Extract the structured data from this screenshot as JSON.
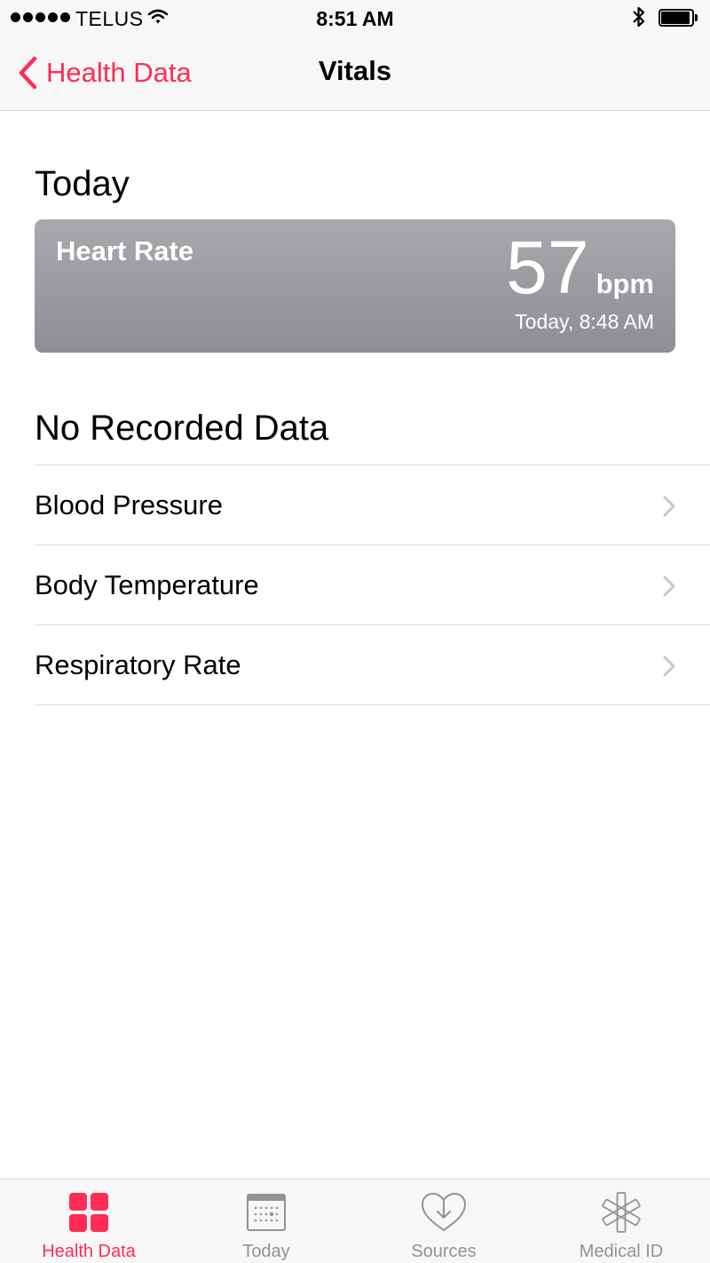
{
  "status_bar": {
    "carrier": "TELUS",
    "time": "8:51 AM",
    "battery_level": 0.95
  },
  "nav": {
    "back_label": "Health Data",
    "title": "Vitals"
  },
  "today_section": {
    "title": "Today",
    "card": {
      "name": "Heart Rate",
      "value": "57",
      "unit": "bpm",
      "timestamp": "Today, 8:48 AM"
    }
  },
  "no_data_section": {
    "title": "No Recorded Data",
    "items": [
      {
        "label": "Blood Pressure"
      },
      {
        "label": "Body Temperature"
      },
      {
        "label": "Respiratory Rate"
      }
    ]
  },
  "tabs": [
    {
      "label": "Health Data",
      "icon": "health-data-grid-icon",
      "active": true
    },
    {
      "label": "Today",
      "icon": "calendar-icon",
      "active": false
    },
    {
      "label": "Sources",
      "icon": "sources-heart-download-icon",
      "active": false
    },
    {
      "label": "Medical ID",
      "icon": "medical-asterisk-icon",
      "active": false
    }
  ],
  "colors": {
    "accent": "#ff2d55",
    "card_top": "#a9a9ad",
    "card_bottom": "#8e8e93",
    "tab_inactive": "#929292"
  }
}
